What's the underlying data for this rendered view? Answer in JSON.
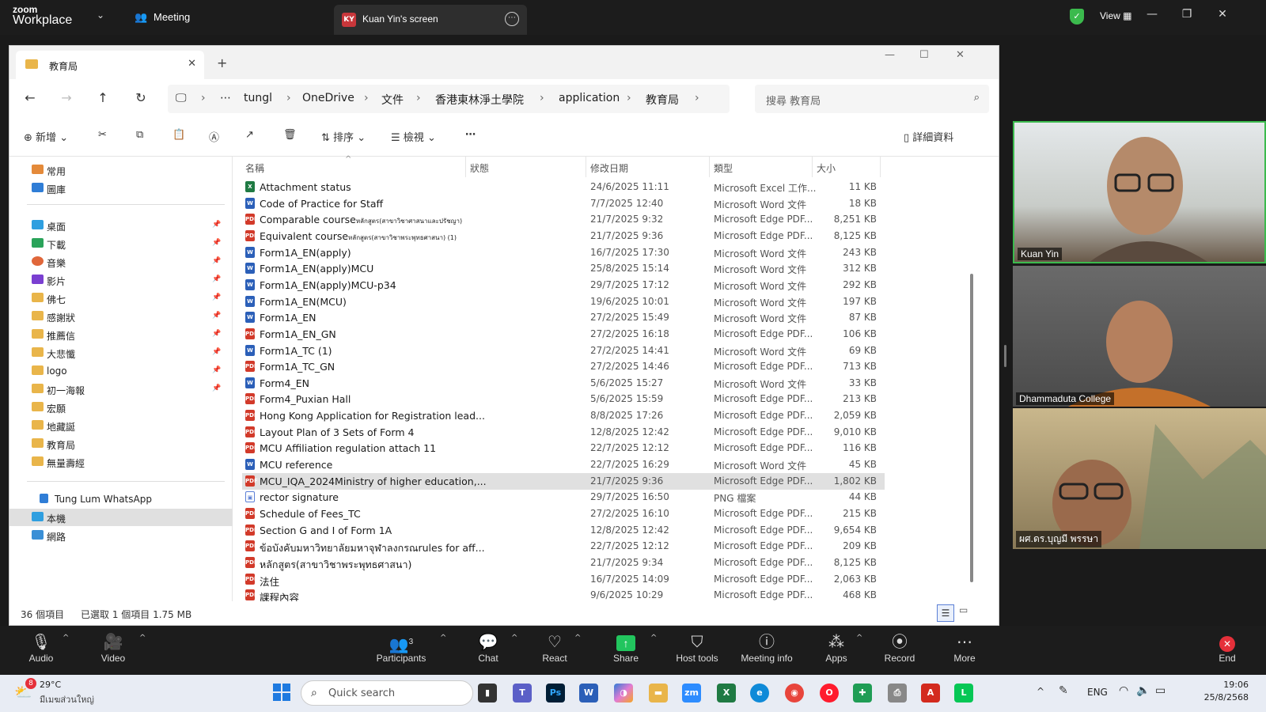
{
  "zoom": {
    "logo_line1": "zoom",
    "logo_line2": "Workplace",
    "meeting_label": "Meeting",
    "share_avatar": "KY",
    "share_tab": "Kuan Yin's screen",
    "view_label": "View"
  },
  "explorer": {
    "tab_title": "教育局",
    "breadcrumb": [
      "tungl",
      "OneDrive",
      "文件",
      "香港東林淨土學院",
      "application",
      "教育局"
    ],
    "search_placeholder": "搜尋 教育局",
    "toolbar": {
      "new": "新增",
      "sort": "排序",
      "view": "檢視",
      "details": "詳細資料"
    },
    "sidebar": {
      "quick": [
        {
          "label": "常用"
        },
        {
          "label": "圖庫"
        }
      ],
      "pinned": [
        {
          "label": "桌面"
        },
        {
          "label": "下載"
        },
        {
          "label": "音樂"
        },
        {
          "label": "影片"
        },
        {
          "label": "佛七"
        },
        {
          "label": "感謝狀"
        },
        {
          "label": "推薦信"
        },
        {
          "label": "大悲懺"
        },
        {
          "label": "logo"
        },
        {
          "label": "初一海報"
        },
        {
          "label": "宏願"
        },
        {
          "label": "地藏誕"
        },
        {
          "label": "教育局"
        },
        {
          "label": "無量壽經"
        }
      ],
      "other": [
        {
          "label": "Tung Lum WhatsApp"
        },
        {
          "label": "本機"
        },
        {
          "label": "網路"
        }
      ]
    },
    "columns": {
      "name": "名稱",
      "status": "狀態",
      "date": "修改日期",
      "type": "類型",
      "size": "大小"
    },
    "files": [
      {
        "name": "Attachment status",
        "date": "24/6/2025 11:11",
        "type": "Microsoft Excel 工作...",
        "size": "11 KB",
        "kind": "xls"
      },
      {
        "name": "Code of Practice for Staff",
        "date": "7/7/2025 12:40",
        "type": "Microsoft Word 文件",
        "size": "18 KB",
        "kind": "word"
      },
      {
        "name": "Comparable course",
        "suffix": "หลักสูตร(สาขาวิชาศาสนาและปรัชญา)",
        "date": "21/7/2025 9:32",
        "type": "Microsoft Edge PDF...",
        "size": "8,251 KB",
        "kind": "pdf"
      },
      {
        "name": "Equivalent course",
        "suffix": "หลักสูตร(สาขาวิชาพระพุทธศาสนา) (1)",
        "date": "21/7/2025 9:36",
        "type": "Microsoft Edge PDF...",
        "size": "8,125 KB",
        "kind": "pdf"
      },
      {
        "name": "Form1A_EN(apply)",
        "date": "16/7/2025 17:30",
        "type": "Microsoft Word 文件",
        "size": "243 KB",
        "kind": "word"
      },
      {
        "name": "Form1A_EN(apply)MCU",
        "date": "25/8/2025 15:14",
        "type": "Microsoft Word 文件",
        "size": "312 KB",
        "kind": "word"
      },
      {
        "name": "Form1A_EN(apply)MCU-p34",
        "date": "29/7/2025 17:12",
        "type": "Microsoft Word 文件",
        "size": "292 KB",
        "kind": "word"
      },
      {
        "name": "Form1A_EN(MCU)",
        "date": "19/6/2025 10:01",
        "type": "Microsoft Word 文件",
        "size": "197 KB",
        "kind": "word"
      },
      {
        "name": "Form1A_EN",
        "date": "27/2/2025 15:49",
        "type": "Microsoft Word 文件",
        "size": "87 KB",
        "kind": "word"
      },
      {
        "name": "Form1A_EN_GN",
        "date": "27/2/2025 16:18",
        "type": "Microsoft Edge PDF...",
        "size": "106 KB",
        "kind": "pdf"
      },
      {
        "name": "Form1A_TC (1)",
        "date": "27/2/2025 14:41",
        "type": "Microsoft Word 文件",
        "size": "69 KB",
        "kind": "word"
      },
      {
        "name": "Form1A_TC_GN",
        "date": "27/2/2025 14:46",
        "type": "Microsoft Edge PDF...",
        "size": "713 KB",
        "kind": "pdf"
      },
      {
        "name": "Form4_EN",
        "date": "5/6/2025 15:27",
        "type": "Microsoft Word 文件",
        "size": "33 KB",
        "kind": "word"
      },
      {
        "name": "Form4_Puxian Hall",
        "date": "5/6/2025 15:59",
        "type": "Microsoft Edge PDF...",
        "size": "213 KB",
        "kind": "pdf"
      },
      {
        "name": "Hong Kong Application for Registration lead...",
        "date": "8/8/2025 17:26",
        "type": "Microsoft Edge PDF...",
        "size": "2,059 KB",
        "kind": "pdf"
      },
      {
        "name": "Layout Plan of 3 Sets of Form 4",
        "date": "12/8/2025 12:42",
        "type": "Microsoft Edge PDF...",
        "size": "9,010 KB",
        "kind": "pdf"
      },
      {
        "name": "MCU Affiliation regulation attach 11",
        "date": "22/7/2025 12:12",
        "type": "Microsoft Edge PDF...",
        "size": "116 KB",
        "kind": "pdf"
      },
      {
        "name": "MCU reference",
        "date": "22/7/2025 16:29",
        "type": "Microsoft Word 文件",
        "size": "45 KB",
        "kind": "word"
      },
      {
        "name": "MCU_IQA_2024Ministry of higher education,...",
        "date": "21/7/2025 9:36",
        "type": "Microsoft Edge PDF...",
        "size": "1,802 KB",
        "kind": "pdf",
        "selected": true
      },
      {
        "name": "rector signature",
        "date": "29/7/2025 16:50",
        "type": "PNG 檔案",
        "size": "44 KB",
        "kind": "png"
      },
      {
        "name": "Schedule of Fees_TC",
        "date": "27/2/2025 16:10",
        "type": "Microsoft Edge PDF...",
        "size": "215 KB",
        "kind": "pdf"
      },
      {
        "name": "Section G and I of Form 1A",
        "date": "12/8/2025 12:42",
        "type": "Microsoft Edge PDF...",
        "size": "9,654 KB",
        "kind": "pdf"
      },
      {
        "name": "ข้อบังคับมหาวิทยาลัยมหาจุฬาลงกรณrules for aff...",
        "date": "22/7/2025 12:12",
        "type": "Microsoft Edge PDF...",
        "size": "209 KB",
        "kind": "pdf"
      },
      {
        "name": "หลักสูตร(สาขาวิชาพระพุทธศาสนา)",
        "date": "21/7/2025 9:34",
        "type": "Microsoft Edge PDF...",
        "size": "8,125 KB",
        "kind": "pdf"
      },
      {
        "name": "法住",
        "date": "16/7/2025 14:09",
        "type": "Microsoft Edge PDF...",
        "size": "2,063 KB",
        "kind": "pdf"
      },
      {
        "name": "課程內容",
        "date": "9/6/2025 10:29",
        "type": "Microsoft Edge PDF...",
        "size": "468 KB",
        "kind": "pdf"
      }
    ],
    "status_count": "36 個項目",
    "status_selected": "已選取 1 個項目 1.75 MB"
  },
  "participants": [
    {
      "name": "Kuan Yin"
    },
    {
      "name": "Dhammaduta College"
    },
    {
      "name": "ผศ.ดร.บุญมี พรรษา"
    }
  ],
  "controls": {
    "audio": "Audio",
    "video": "Video",
    "participants": "Participants",
    "participants_count": "3",
    "chat": "Chat",
    "react": "React",
    "share": "Share",
    "host_tools": "Host tools",
    "meeting_info": "Meeting info",
    "apps": "Apps",
    "record": "Record",
    "more": "More",
    "end": "End"
  },
  "taskbar": {
    "weather_badge": "8",
    "weather_temp": "29°C",
    "weather_desc": "มีเมฆส่วนใหญ่",
    "search": "Quick search",
    "lang": "ENG",
    "time": "19:06",
    "date": "25/8/2568"
  },
  "colors": {
    "accent": "#3bba4d",
    "selected_row": "#e0e0e0",
    "zoom_bg": "#1c1c1c",
    "pdf": "#d23a2a",
    "word": "#2b5fb8"
  }
}
